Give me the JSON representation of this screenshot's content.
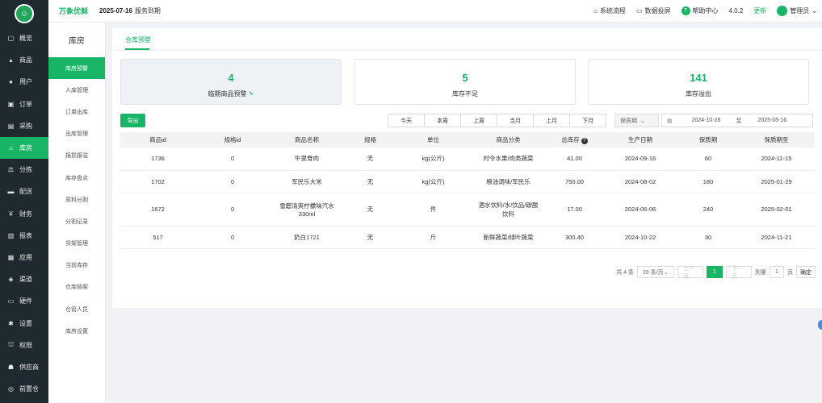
{
  "header": {
    "brand": "万象优鲜",
    "date": "2025-07-16",
    "expire_text": "服务到期",
    "links": {
      "flow": "系统流程",
      "screen": "数据投屏",
      "help": "帮助中心"
    },
    "version": "4.0.2",
    "update": "更新",
    "user": "管理员"
  },
  "sidebar": {
    "items": [
      {
        "icon": "▢",
        "label": "概览"
      },
      {
        "icon": "▴",
        "label": "商品"
      },
      {
        "icon": "●",
        "label": "用户"
      },
      {
        "icon": "▣",
        "label": "订单"
      },
      {
        "icon": "▤",
        "label": "采购"
      },
      {
        "icon": "⌂",
        "label": "库房"
      },
      {
        "icon": "⚖",
        "label": "分拣"
      },
      {
        "icon": "▬",
        "label": "配送"
      },
      {
        "icon": "¥",
        "label": "财务"
      },
      {
        "icon": "▥",
        "label": "报表"
      },
      {
        "icon": "▦",
        "label": "应用"
      },
      {
        "icon": "◈",
        "label": "渠道"
      },
      {
        "icon": "▭",
        "label": "硬件"
      },
      {
        "icon": "✱",
        "label": "设置"
      },
      {
        "icon": "⛫",
        "label": "权限"
      },
      {
        "icon": "☗",
        "label": "供应商"
      },
      {
        "icon": "◎",
        "label": "前置仓"
      }
    ]
  },
  "subnav": {
    "title": "库房",
    "items": [
      "库房预警",
      "入库管理",
      "订单出库",
      "出库管理",
      "报损报溢",
      "库存盘点",
      "原料分割",
      "分割记录",
      "货架管理",
      "当前库存",
      "仓库档案",
      "仓管人员",
      "库房设置"
    ]
  },
  "main": {
    "tab": "仓库预警",
    "cards": [
      {
        "value": "4",
        "label": "临期商品预警"
      },
      {
        "value": "5",
        "label": "库存不足"
      },
      {
        "value": "141",
        "label": "库存溢出"
      }
    ],
    "export": "导出",
    "date_tabs": [
      "今天",
      "本周",
      "上周",
      "当月",
      "上月",
      "下月"
    ],
    "filter": "保质期",
    "date_start": "2024-10-28",
    "date_sep": "至",
    "date_end": "2025-05-16"
  },
  "table": {
    "headers": [
      "商品id",
      "规格id",
      "商品名称",
      "规格",
      "单位",
      "商品分类",
      "总库存",
      "生产日期",
      "保质期",
      "保质期至"
    ],
    "rows": [
      [
        "1736",
        "0",
        "牛里脊肉",
        "无",
        "kg(公斤)",
        "时令水果/肉类蔬菜",
        "41.00",
        "2024-09-16",
        "60",
        "2024-11-15"
      ],
      [
        "1702",
        "0",
        "军民乐大米",
        "无",
        "kg(公斤)",
        "粮油调味/军民乐",
        "750.00",
        "2024-08-02",
        "180",
        "2025-01-29"
      ],
      [
        "1672",
        "0",
        "雪碧清爽柠檬味汽水330ml",
        "无",
        "件",
        "酒水饮料/水/饮品/碳酸饮料",
        "17.00",
        "2024-06-06",
        "240",
        "2025-02-01"
      ],
      [
        "517",
        "0",
        "奶白1721",
        "无",
        "斤",
        "新鲜蔬菜/绿叶蔬菜",
        "300.40",
        "2024-10-22",
        "30",
        "2024-11-21"
      ]
    ]
  },
  "pager": {
    "total": "共 4 条",
    "size": "20 条/页",
    "prev": "上一页",
    "current": "1",
    "next": "下一页",
    "goto": "到第",
    "goto_value": "1",
    "page_unit": "页",
    "confirm": "确定"
  }
}
